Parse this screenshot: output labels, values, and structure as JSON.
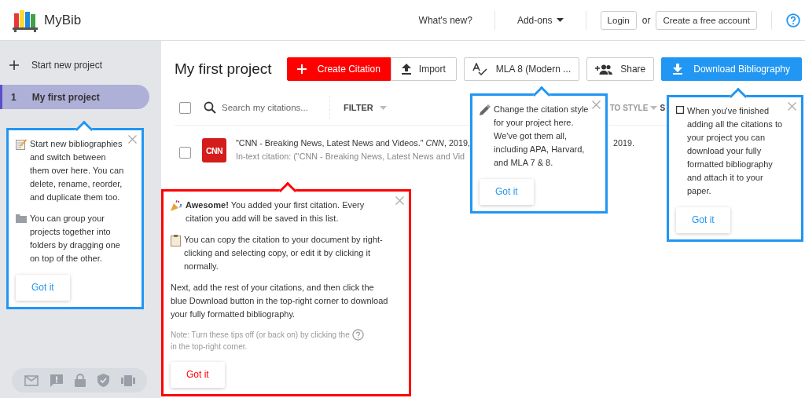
{
  "header": {
    "logo_text": "MyBib",
    "nav": [
      {
        "label": "What's new?",
        "kind": "link"
      },
      {
        "label": "Add-ons",
        "kind": "dropdown"
      }
    ],
    "login": "Login",
    "or": "or",
    "signup": "Create a free account"
  },
  "sidebar": {
    "new_project": "Start new project",
    "projects": [
      {
        "number": "1",
        "name": "My first project",
        "selected": true
      }
    ]
  },
  "project": {
    "title": "My first project",
    "actions": [
      {
        "label": "Create Citation",
        "kind": "create"
      },
      {
        "label": "Import",
        "kind": "import"
      },
      {
        "label": "MLA 8 (Modern ...",
        "kind": "style"
      },
      {
        "label": "Share",
        "kind": "share"
      },
      {
        "label": "Download Bibliography",
        "kind": "download"
      }
    ]
  },
  "toolbar": {
    "select_all_checked": false,
    "search_placeholder": "Search my citations...",
    "filter": "FILTER",
    "sort_visible": "TO STYLE",
    "show_visible": "S"
  },
  "citations": [
    {
      "checked": false,
      "source": "CNN",
      "reference": "\"CNN - Breaking News, Latest News and Videos.\" *CNN*, 2019,",
      "reference_tail": "2019.",
      "in_text": "In-text citation: (\"CNN - Breaking News, Latest News and Vid"
    }
  ],
  "tips": [
    {
      "color": "#2196f3",
      "paragraphs": [
        {
          "kind": "memo",
          "text": "Start new bibliographies and switch between them over here. You can delete, rename, reorder, and duplicate them too."
        },
        {
          "kind": "folder",
          "text": "You can group your projects together into folders by dragging one on top of the other."
        }
      ],
      "button": "Got it"
    },
    {
      "color": "#ff0000",
      "paragraphs": [
        {
          "kind": "party",
          "text": "**Awesome!** You added your first citation. Every citation you add will be saved in this list."
        },
        {
          "kind": "clipboard",
          "text": "You can copy the citation to your document by right-clicking and selecting copy, or edit it by clicking it normally."
        },
        {
          "kind": "plain",
          "text": "Next, add the rest of your citations, and then click the blue Download button in the top-right corner to download your fully formatted bibliography."
        },
        {
          "kind": "note",
          "text": "Note: Turn these tips off (or back on) by clicking the",
          "text_after": "in the top-right corner."
        }
      ],
      "button": "Got it"
    },
    {
      "color": "#2196f3",
      "paragraphs": [
        {
          "kind": "pencil",
          "text": "Change the citation style for your project here. We've got them all, including APA, Harvard, and MLA 7 & 8."
        }
      ],
      "button": "Got it"
    },
    {
      "color": "#2196f3",
      "paragraphs": [
        {
          "kind": "square",
          "text": "When you've finished adding all the citations to your project you can download your fully formatted bibliography and attach it to your paper."
        }
      ],
      "button": "Got it"
    }
  ]
}
